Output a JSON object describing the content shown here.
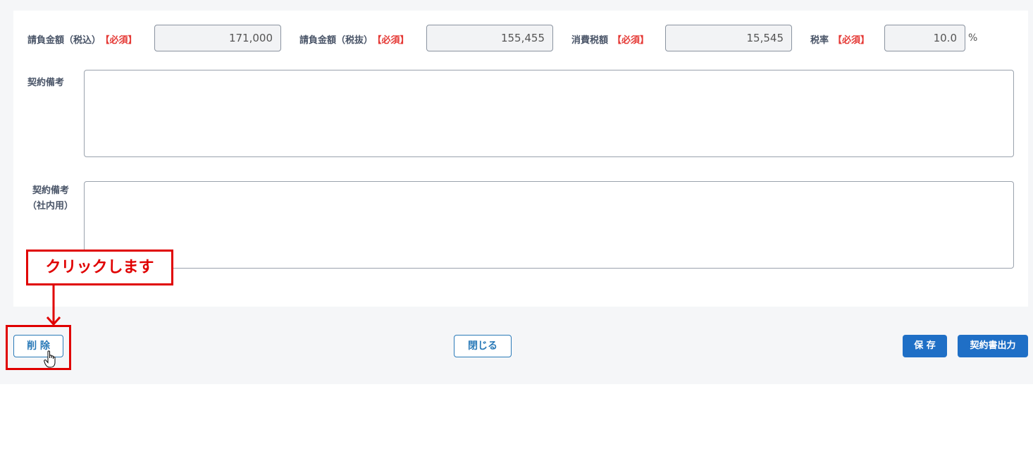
{
  "amounts": {
    "incl_tax_label": "請負金額（税込）",
    "incl_tax_value": "171,000",
    "excl_tax_label": "請負金額（税抜）",
    "excl_tax_value": "155,455",
    "consumption_tax_label": "消費税額",
    "consumption_tax_value": "15,545",
    "tax_rate_label": "税率",
    "tax_rate_value": "10.0",
    "tax_rate_unit": "%",
    "required_mark": "【必須】"
  },
  "remarks": {
    "label": "契約備考",
    "value": ""
  },
  "internal_remarks": {
    "label_line1": "契約備考",
    "label_line2": "（社内用）",
    "value": ""
  },
  "footer": {
    "delete_label": "削 除",
    "close_label": "閉じる",
    "save_label": "保 存",
    "export_label": "契約書出力"
  },
  "annotation": {
    "callout_text": "クリックします",
    "color": "#e00000"
  },
  "colors": {
    "primary": "#1f6fc6",
    "required": "#e53935"
  }
}
